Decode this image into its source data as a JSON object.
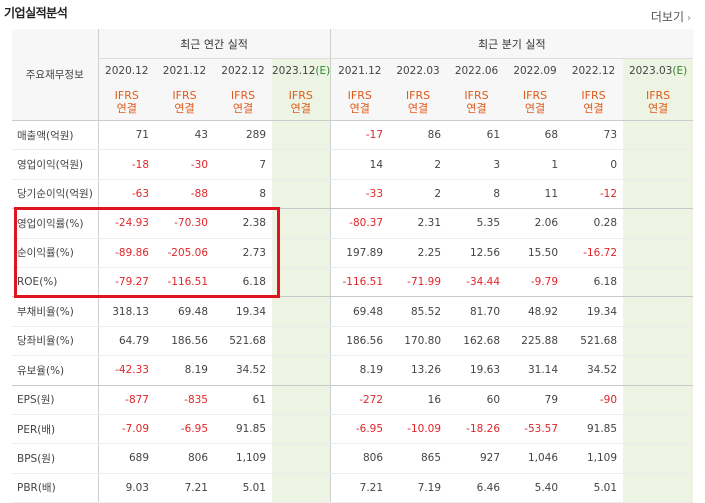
{
  "header": {
    "title": "기업실적분석",
    "more_label": "더보기"
  },
  "table": {
    "row_header_label": "주요재무정보",
    "group_annual": "최근 연간 실적",
    "group_quarterly": "최근 분기 실적",
    "annual_periods": [
      "2020.12",
      "2021.12",
      "2022.12"
    ],
    "annual_estimate": {
      "period": "2023.12",
      "mark": "(E)"
    },
    "quarter_periods": [
      "2021.12",
      "2022.03",
      "2022.06",
      "2022.09",
      "2022.12"
    ],
    "quarter_estimate": {
      "period": "2023.03",
      "mark": "(E)"
    },
    "basis_line1": "IFRS",
    "basis_line2": "연결",
    "rows": [
      {
        "label": "매출액(억원)",
        "annual": [
          "71",
          "43",
          "289",
          ""
        ],
        "quarter": [
          "-17",
          "86",
          "61",
          "68",
          "73",
          ""
        ]
      },
      {
        "label": "영업이익(억원)",
        "annual": [
          "-18",
          "-30",
          "7",
          ""
        ],
        "quarter": [
          "14",
          "2",
          "3",
          "1",
          "0",
          ""
        ]
      },
      {
        "label": "당기순이익(억원)",
        "annual": [
          "-63",
          "-88",
          "8",
          ""
        ],
        "quarter": [
          "-33",
          "2",
          "8",
          "11",
          "-12",
          ""
        ]
      },
      {
        "label": "영업이익률(%)",
        "annual": [
          "-24.93",
          "-70.30",
          "2.38",
          ""
        ],
        "quarter": [
          "-80.37",
          "2.31",
          "5.35",
          "2.06",
          "0.28",
          ""
        ]
      },
      {
        "label": "순이익률(%)",
        "annual": [
          "-89.86",
          "-205.06",
          "2.73",
          ""
        ],
        "quarter": [
          "197.89",
          "2.25",
          "12.56",
          "15.50",
          "-16.72",
          ""
        ]
      },
      {
        "label": "ROE(%)",
        "annual": [
          "-79.27",
          "-116.51",
          "6.18",
          ""
        ],
        "quarter": [
          "-116.51",
          "-71.99",
          "-34.44",
          "-9.79",
          "6.18",
          ""
        ]
      },
      {
        "label": "부채비율(%)",
        "annual": [
          "318.13",
          "69.48",
          "19.34",
          ""
        ],
        "quarter": [
          "69.48",
          "85.52",
          "81.70",
          "48.92",
          "19.34",
          ""
        ]
      },
      {
        "label": "당좌비율(%)",
        "annual": [
          "64.79",
          "186.56",
          "521.68",
          ""
        ],
        "quarter": [
          "186.56",
          "170.80",
          "162.68",
          "225.88",
          "521.68",
          ""
        ]
      },
      {
        "label": "유보율(%)",
        "annual": [
          "-42.33",
          "8.19",
          "34.52",
          ""
        ],
        "quarter": [
          "8.19",
          "13.26",
          "19.63",
          "31.14",
          "34.52",
          ""
        ]
      },
      {
        "label": "EPS(원)",
        "annual": [
          "-877",
          "-835",
          "61",
          ""
        ],
        "quarter": [
          "-272",
          "16",
          "60",
          "79",
          "-90",
          ""
        ]
      },
      {
        "label": "PER(배)",
        "annual": [
          "-7.09",
          "-6.95",
          "91.85",
          ""
        ],
        "quarter": [
          "-6.95",
          "-10.09",
          "-18.26",
          "-53.57",
          "91.85",
          ""
        ]
      },
      {
        "label": "BPS(원)",
        "annual": [
          "689",
          "806",
          "1,109",
          ""
        ],
        "quarter": [
          "806",
          "865",
          "927",
          "1,046",
          "1,109",
          ""
        ]
      },
      {
        "label": "PBR(배)",
        "annual": [
          "9.03",
          "7.21",
          "5.01",
          ""
        ],
        "quarter": [
          "7.21",
          "7.19",
          "6.46",
          "5.40",
          "5.01",
          ""
        ]
      }
    ],
    "group_end_rows": [
      2,
      5,
      8
    ],
    "highlight_rows": [
      3,
      4,
      5
    ]
  },
  "colors": {
    "negative": "#e0262b",
    "basis": "#e05a1a",
    "estimate_mark": "#2a8a2a",
    "estimate_bg": "#eef4e4",
    "highlight_box": "#e0141e"
  }
}
